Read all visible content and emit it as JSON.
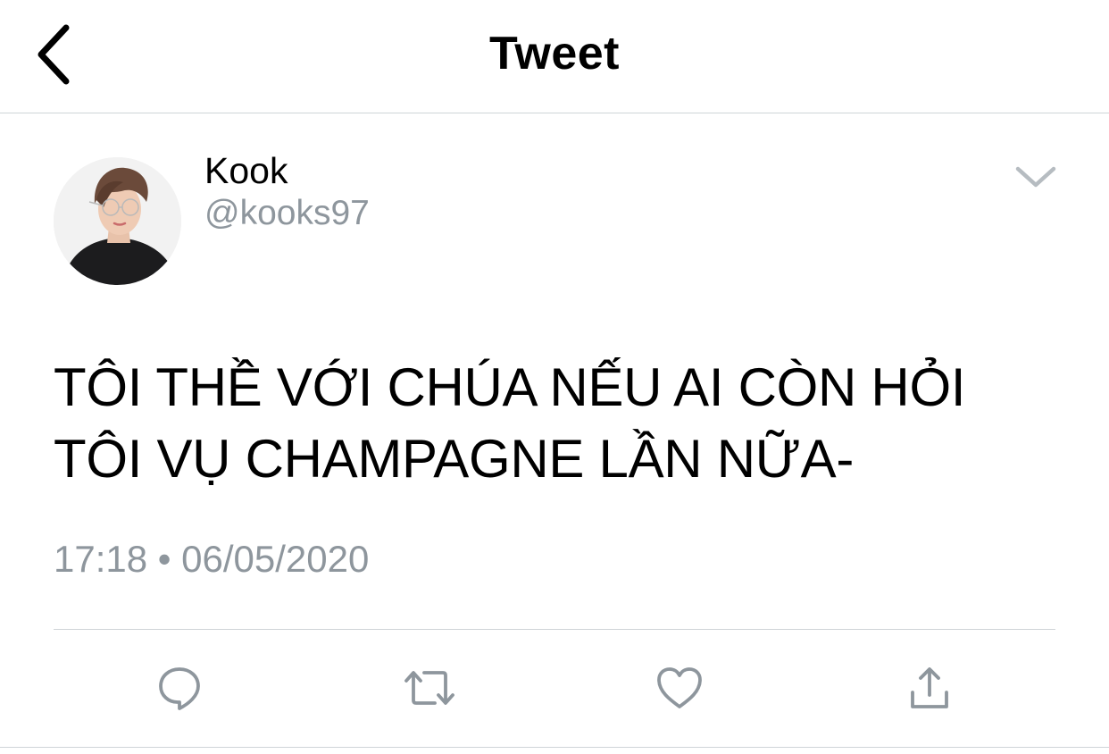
{
  "header": {
    "title": "Tweet",
    "back_icon": "chevron-left-icon"
  },
  "tweet": {
    "author": {
      "display_name": "Kook",
      "handle": "@kooks97"
    },
    "text": "TÔI THỀ VỚI CHÚA NẾU AI CÒN HỎI\nTÔI VỤ CHAMPAGNE LẦN NỮA-",
    "timestamp": "17:18 • 06/05/2020",
    "more_icon": "chevron-down-icon"
  },
  "actions": [
    {
      "name": "reply",
      "icon": "reply-icon"
    },
    {
      "name": "retweet",
      "icon": "retweet-icon"
    },
    {
      "name": "like",
      "icon": "heart-icon"
    },
    {
      "name": "share",
      "icon": "share-icon"
    }
  ],
  "colors": {
    "text": "#000000",
    "secondary_text": "#8e969d",
    "icon": "#8e969d",
    "divider": "#cfd4d8"
  }
}
